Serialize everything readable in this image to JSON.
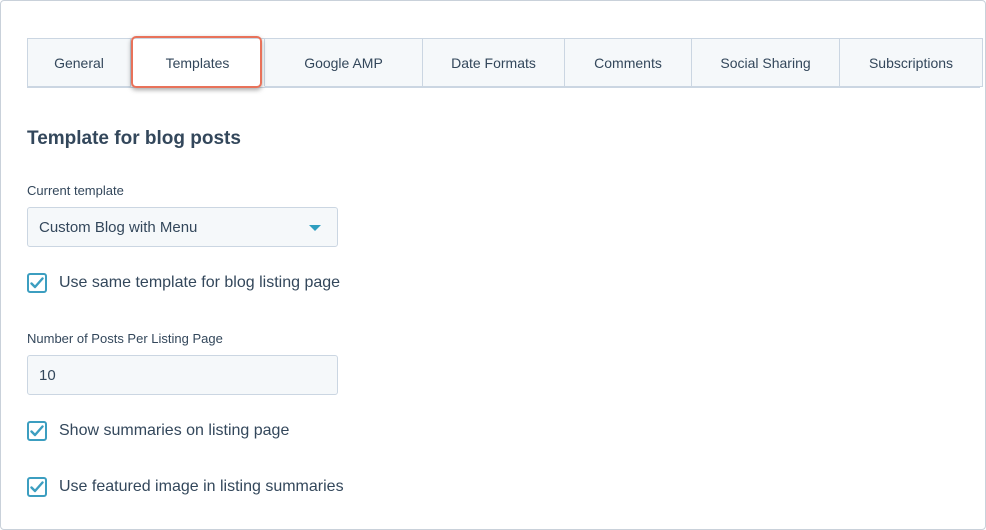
{
  "tabs": [
    {
      "label": "General",
      "active": false
    },
    {
      "label": "Templates",
      "active": true
    },
    {
      "label": "Google AMP",
      "active": false
    },
    {
      "label": "Date Formats",
      "active": false
    },
    {
      "label": "Comments",
      "active": false
    },
    {
      "label": "Social Sharing",
      "active": false
    },
    {
      "label": "Subscriptions",
      "active": false
    }
  ],
  "section": {
    "title": "Template for blog posts"
  },
  "current_template": {
    "label": "Current template",
    "value": "Custom Blog with Menu",
    "icon": "chevron-down-icon"
  },
  "same_template": {
    "label": "Use same template for blog listing page",
    "checked": true
  },
  "posts_per_page": {
    "label": "Number of Posts Per Listing Page",
    "value": "10"
  },
  "show_summaries": {
    "label": "Show summaries on listing page",
    "checked": true
  },
  "featured_image": {
    "label": "Use featured image in listing summaries",
    "checked": true
  },
  "colors": {
    "accent": "#3c9ec0",
    "highlight": "#e8725a",
    "text": "#33475b",
    "field_bg": "#f5f8fa",
    "border": "#cbd6e2"
  }
}
